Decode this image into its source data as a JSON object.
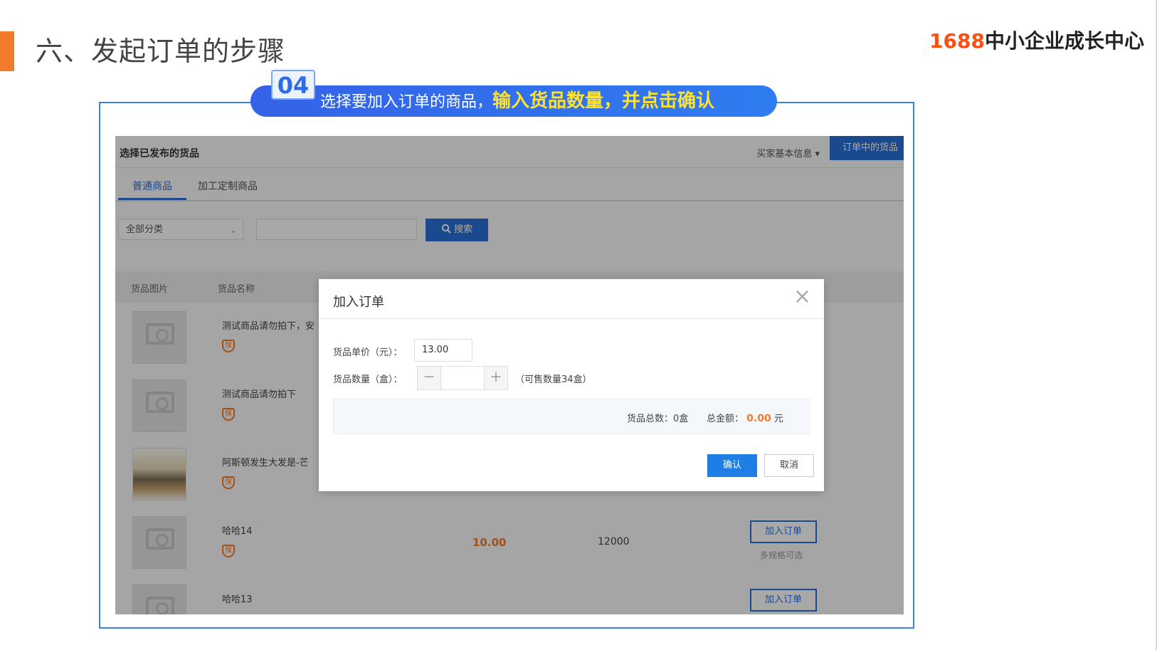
{
  "slide": {
    "title": "六、发起订单的步骤",
    "brand_number": "1688",
    "brand_text": "中小企业成长中心"
  },
  "step": {
    "number": "04",
    "text_plain": "选择要加入订单的商品，",
    "text_highlight": "输入货品数量，并点击确认"
  },
  "screen": {
    "title": "选择已发布的货品",
    "buyer_info": "买家基本信息",
    "order_goods": "订单中的货品",
    "tabs": [
      {
        "label": "普通商品"
      },
      {
        "label": "加工定制商品"
      }
    ],
    "filter": {
      "category": "全部分类",
      "search_value": "",
      "search_button": "搜索"
    },
    "table": {
      "headers": [
        "货品图片",
        "货品名称"
      ],
      "rows": [
        {
          "name": "测试商品请勿拍下，安",
          "price": "",
          "stock": "",
          "action": "",
          "note": ""
        },
        {
          "name": "测试商品请勿拍下",
          "price": "",
          "stock": "",
          "action": "",
          "note": ""
        },
        {
          "name": "阿斯顿发生大发是-芒",
          "price": "",
          "stock": "",
          "action": "",
          "note": ""
        },
        {
          "name": "哈哈14",
          "price": "10.00",
          "stock": "12000",
          "action": "加入订单",
          "note": "多规格可选"
        },
        {
          "name": "哈哈13",
          "price": "",
          "stock": "",
          "action": "加入订单",
          "note": ""
        }
      ]
    }
  },
  "modal": {
    "title": "加入订单",
    "close_icon": "×",
    "price_label": "货品单价（元）：",
    "price_value": "13.00",
    "qty_label": "货品数量（盒）：",
    "qty_value": "",
    "minus": "－",
    "plus": "＋",
    "available": "（可售数量34盒）",
    "total_count_label": "货品总数：",
    "total_count_value": "0盒",
    "total_amount_label": "总金额：",
    "total_amount_value": "0.00",
    "currency": "元",
    "confirm": "确认",
    "cancel": "取消"
  },
  "colors": {
    "accent": "#f07b2a",
    "primary": "#2a6fd6",
    "highlight": "#ffe22e"
  }
}
